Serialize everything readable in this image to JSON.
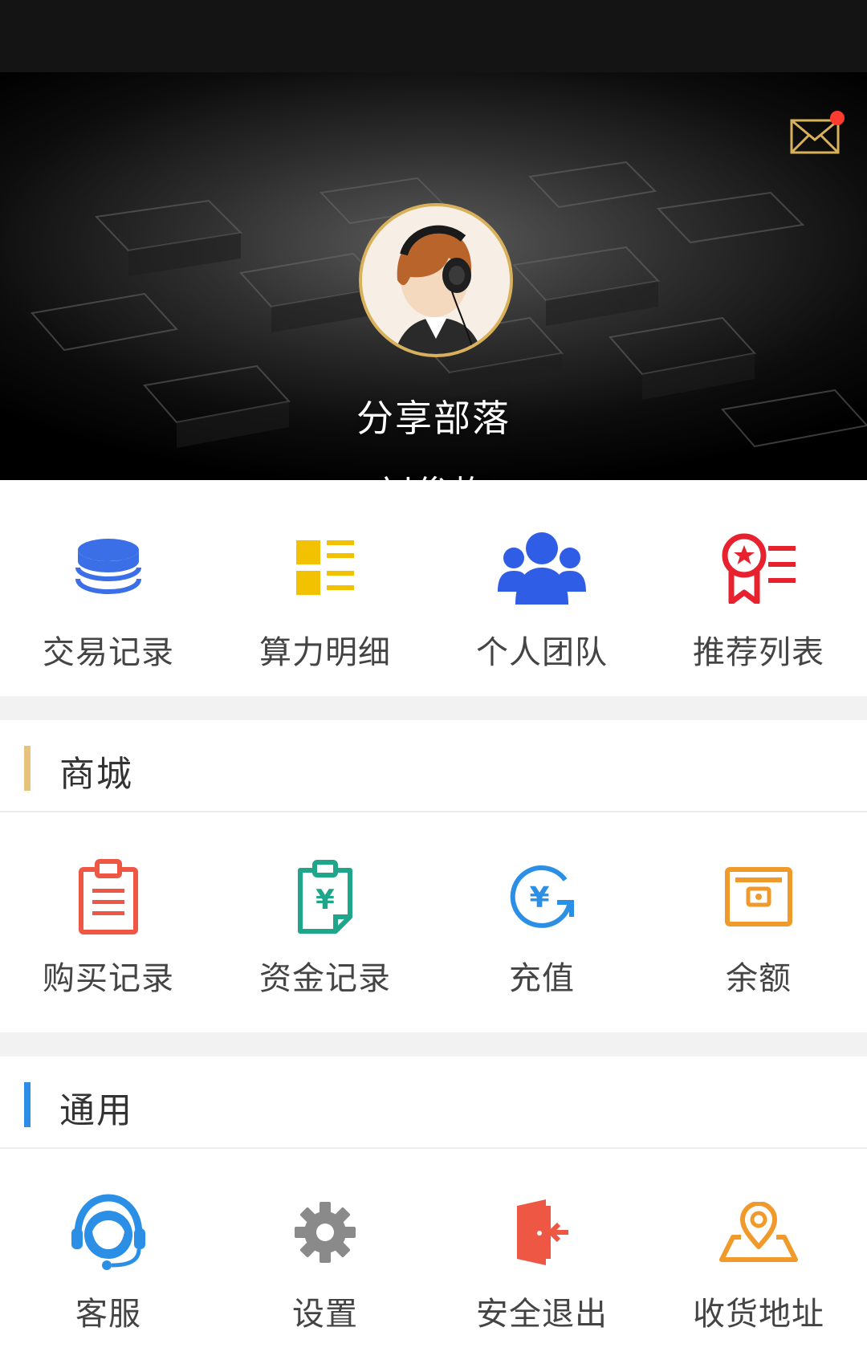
{
  "header": {
    "title": "分享部落",
    "user_name": "刘俊梅",
    "mail_icon": "mail-icon",
    "has_unread": true
  },
  "quick_links": [
    {
      "label": "交易记录",
      "icon": "database-icon",
      "color": "#3b6fe8"
    },
    {
      "label": "算力明细",
      "icon": "list-grid-icon",
      "color": "#f2c200"
    },
    {
      "label": "个人团队",
      "icon": "team-icon",
      "color": "#2f5de6"
    },
    {
      "label": "推荐列表",
      "icon": "award-list-icon",
      "color": "#e8212f"
    }
  ],
  "sections": [
    {
      "title": "商城",
      "accent": "#e7c27a",
      "items": [
        {
          "label": "购买记录",
          "icon": "clipboard-icon",
          "color": "#ee5744"
        },
        {
          "label": "资金记录",
          "icon": "yuan-clipboard-icon",
          "color": "#1fa58a"
        },
        {
          "label": "充值",
          "icon": "yuan-refresh-icon",
          "color": "#2c8fe6"
        },
        {
          "label": "余额",
          "icon": "wallet-icon",
          "color": "#f19a2c"
        }
      ]
    },
    {
      "title": "通用",
      "accent": "#2c8fe6",
      "items": [
        {
          "label": "客服",
          "icon": "headset-icon",
          "color": "#2c8fe6"
        },
        {
          "label": "设置",
          "icon": "gear-icon",
          "color": "#8a8a8a"
        },
        {
          "label": "安全退出",
          "icon": "exit-door-icon",
          "color": "#ee5744"
        },
        {
          "label": "收货地址",
          "icon": "location-icon",
          "color": "#f19a2c"
        }
      ]
    }
  ]
}
